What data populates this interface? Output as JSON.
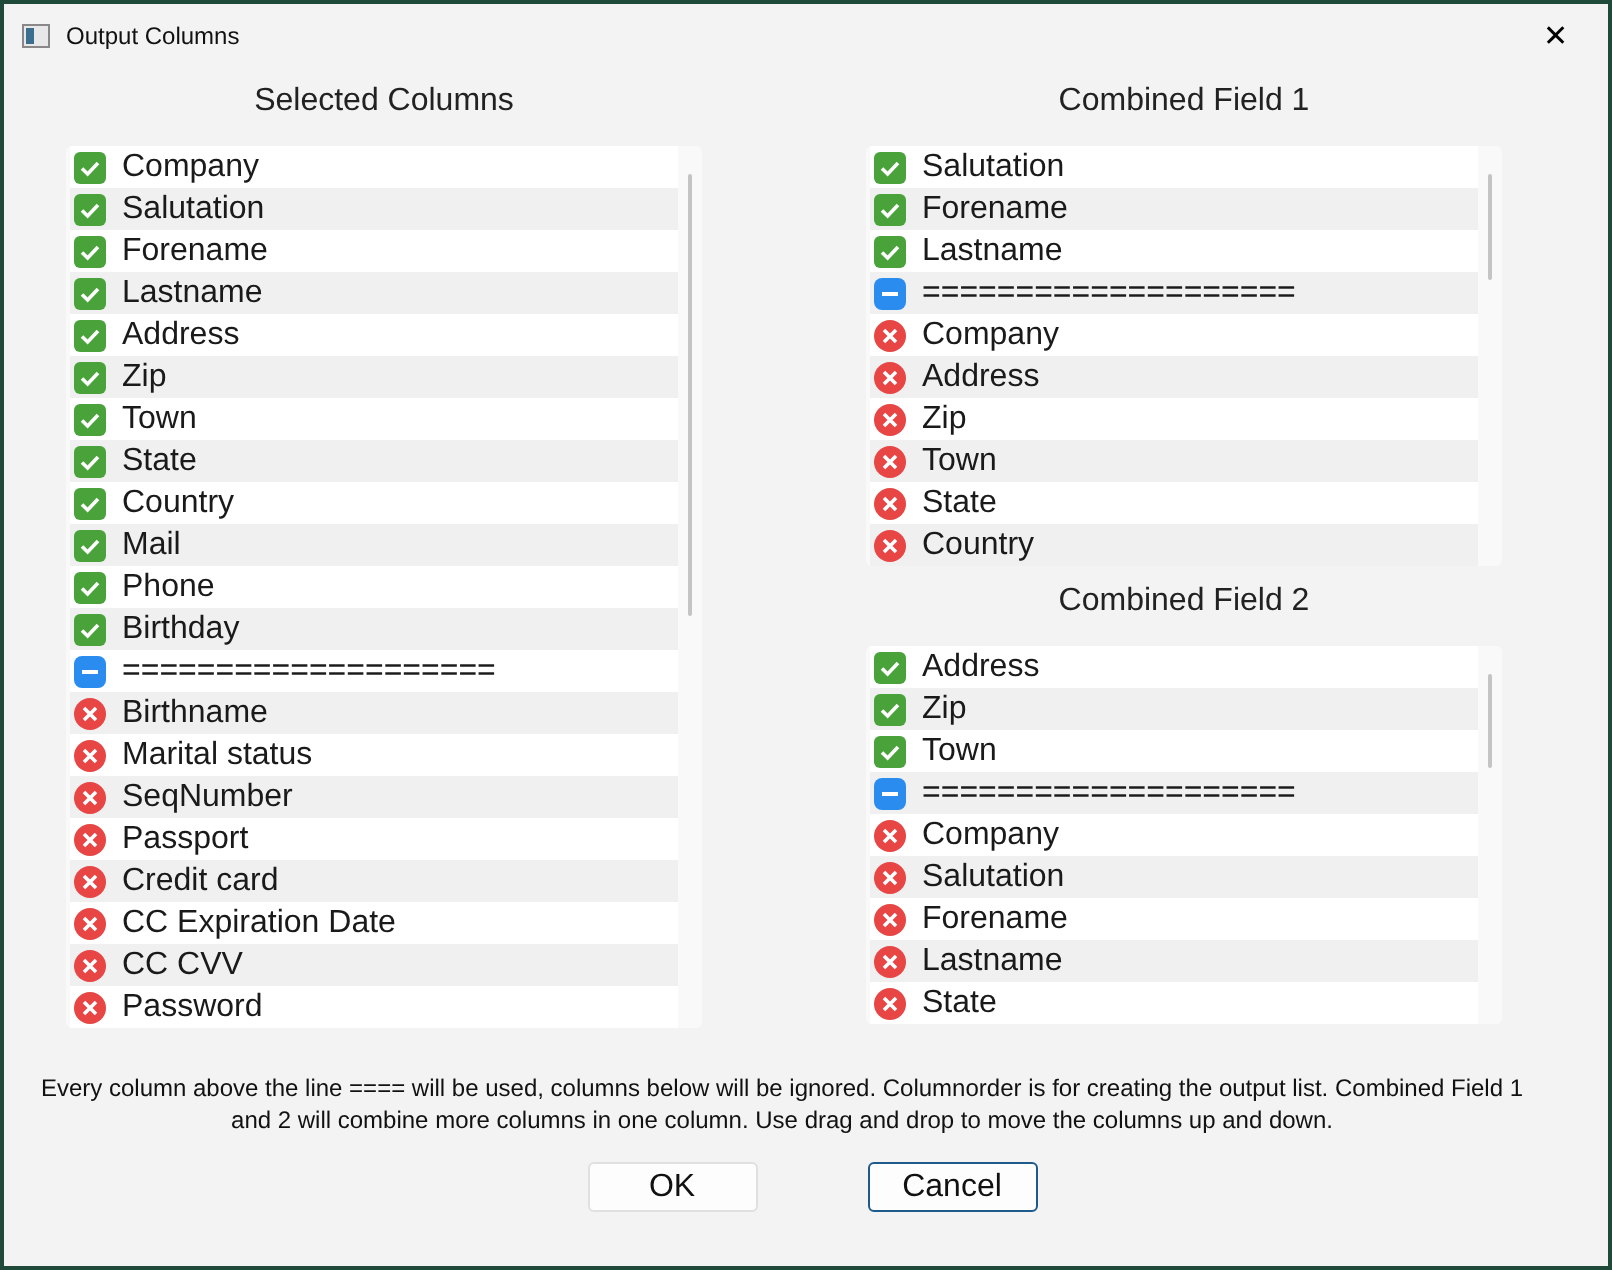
{
  "window": {
    "title": "Output Columns",
    "close": "✕"
  },
  "selected_columns": {
    "title": "Selected Columns",
    "items": [
      {
        "label": "Company",
        "kind": "included"
      },
      {
        "label": "Salutation",
        "kind": "included"
      },
      {
        "label": "Forename",
        "kind": "included"
      },
      {
        "label": "Lastname",
        "kind": "included"
      },
      {
        "label": "Address",
        "kind": "included"
      },
      {
        "label": "Zip",
        "kind": "included"
      },
      {
        "label": "Town",
        "kind": "included"
      },
      {
        "label": "State",
        "kind": "included"
      },
      {
        "label": "Country",
        "kind": "included"
      },
      {
        "label": "Mail",
        "kind": "included"
      },
      {
        "label": "Phone",
        "kind": "included"
      },
      {
        "label": "Birthday",
        "kind": "included"
      },
      {
        "label": "====================",
        "kind": "separator"
      },
      {
        "label": "Birthname",
        "kind": "excluded"
      },
      {
        "label": "Marital status",
        "kind": "excluded"
      },
      {
        "label": "SeqNumber",
        "kind": "excluded"
      },
      {
        "label": "Passport",
        "kind": "excluded"
      },
      {
        "label": "Credit card",
        "kind": "excluded"
      },
      {
        "label": "CC Expiration Date",
        "kind": "excluded"
      },
      {
        "label": "CC CVV",
        "kind": "excluded"
      },
      {
        "label": "Password",
        "kind": "excluded"
      }
    ]
  },
  "combined_field_1": {
    "title": "Combined Field 1",
    "items": [
      {
        "label": "Salutation",
        "kind": "included"
      },
      {
        "label": "Forename",
        "kind": "included"
      },
      {
        "label": "Lastname",
        "kind": "included"
      },
      {
        "label": "====================",
        "kind": "separator"
      },
      {
        "label": "Company",
        "kind": "excluded"
      },
      {
        "label": "Address",
        "kind": "excluded"
      },
      {
        "label": "Zip",
        "kind": "excluded"
      },
      {
        "label": "Town",
        "kind": "excluded"
      },
      {
        "label": "State",
        "kind": "excluded"
      },
      {
        "label": "Country",
        "kind": "excluded"
      }
    ]
  },
  "combined_field_2": {
    "title": "Combined Field 2",
    "items": [
      {
        "label": "Address",
        "kind": "included"
      },
      {
        "label": "Zip",
        "kind": "included"
      },
      {
        "label": "Town",
        "kind": "included"
      },
      {
        "label": "====================",
        "kind": "separator"
      },
      {
        "label": "Company",
        "kind": "excluded"
      },
      {
        "label": "Salutation",
        "kind": "excluded"
      },
      {
        "label": "Forename",
        "kind": "excluded"
      },
      {
        "label": "Lastname",
        "kind": "excluded"
      },
      {
        "label": "State",
        "kind": "excluded"
      }
    ]
  },
  "help_text": "Every column above the line ==== will be used, columns below will be ignored. Columnorder is for creating the output list. Combined Field 1 and 2 will combine more columns in one column. Use drag and drop to move the columns up and down.",
  "buttons": [
    {
      "label": "OK",
      "default": false
    },
    {
      "label": "Cancel",
      "default": true
    }
  ]
}
